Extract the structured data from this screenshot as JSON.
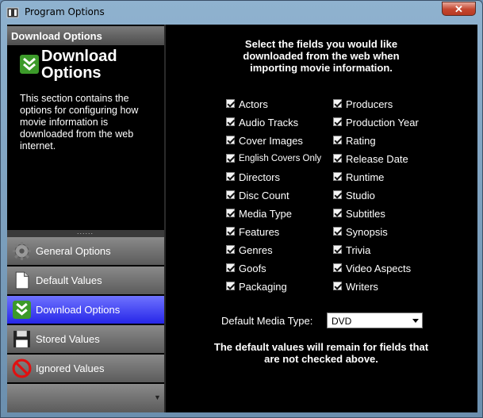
{
  "window": {
    "title": "Program Options",
    "close_label": "✕"
  },
  "left_panel": {
    "header": "Download Options",
    "big_title": "Download Options",
    "description": "This section contains the options for configuring how movie information is downloaded from the web internet.",
    "splitter_grip": "......",
    "nav_items": [
      {
        "label": "General Options",
        "icon": "gear-icon"
      },
      {
        "label": "Default Values",
        "icon": "document-icon"
      },
      {
        "label": "Download Options",
        "icon": "download-icon"
      },
      {
        "label": "Stored Values",
        "icon": "floppy-disk-icon"
      },
      {
        "label": "Ignored Values",
        "icon": "prohibited-icon"
      }
    ],
    "footer_arrow": "▼"
  },
  "main": {
    "instructions": "Select the fields you would like downloaded from the web when importing movie information.",
    "fields_left": [
      {
        "label": "Actors",
        "checked": true
      },
      {
        "label": "Audio Tracks",
        "checked": true
      },
      {
        "label": "Cover Images",
        "checked": true
      },
      {
        "label": "English Covers Only",
        "checked": true
      },
      {
        "label": "Directors",
        "checked": true
      },
      {
        "label": "Disc Count",
        "checked": true
      },
      {
        "label": "Media Type",
        "checked": true
      },
      {
        "label": "Features",
        "checked": true
      },
      {
        "label": "Genres",
        "checked": true
      },
      {
        "label": "Goofs",
        "checked": true
      },
      {
        "label": "Packaging",
        "checked": true
      }
    ],
    "fields_right": [
      {
        "label": "Producers",
        "checked": true
      },
      {
        "label": "Production Year",
        "checked": true
      },
      {
        "label": "Rating",
        "checked": true
      },
      {
        "label": "Release Date",
        "checked": true
      },
      {
        "label": "Runtime",
        "checked": true
      },
      {
        "label": "Studio",
        "checked": true
      },
      {
        "label": "Subtitles",
        "checked": true
      },
      {
        "label": "Synopsis",
        "checked": true
      },
      {
        "label": "Trivia",
        "checked": true
      },
      {
        "label": "Video Aspects",
        "checked": true
      },
      {
        "label": "Writers",
        "checked": true
      }
    ],
    "default_media_type_label": "Default Media Type:",
    "default_media_type_value": "DVD",
    "note": "The default values will remain for fields that are not checked above."
  },
  "colors": {
    "active_nav": "#3a3aff",
    "panel_bg": "#000000",
    "text": "#ffffff"
  }
}
